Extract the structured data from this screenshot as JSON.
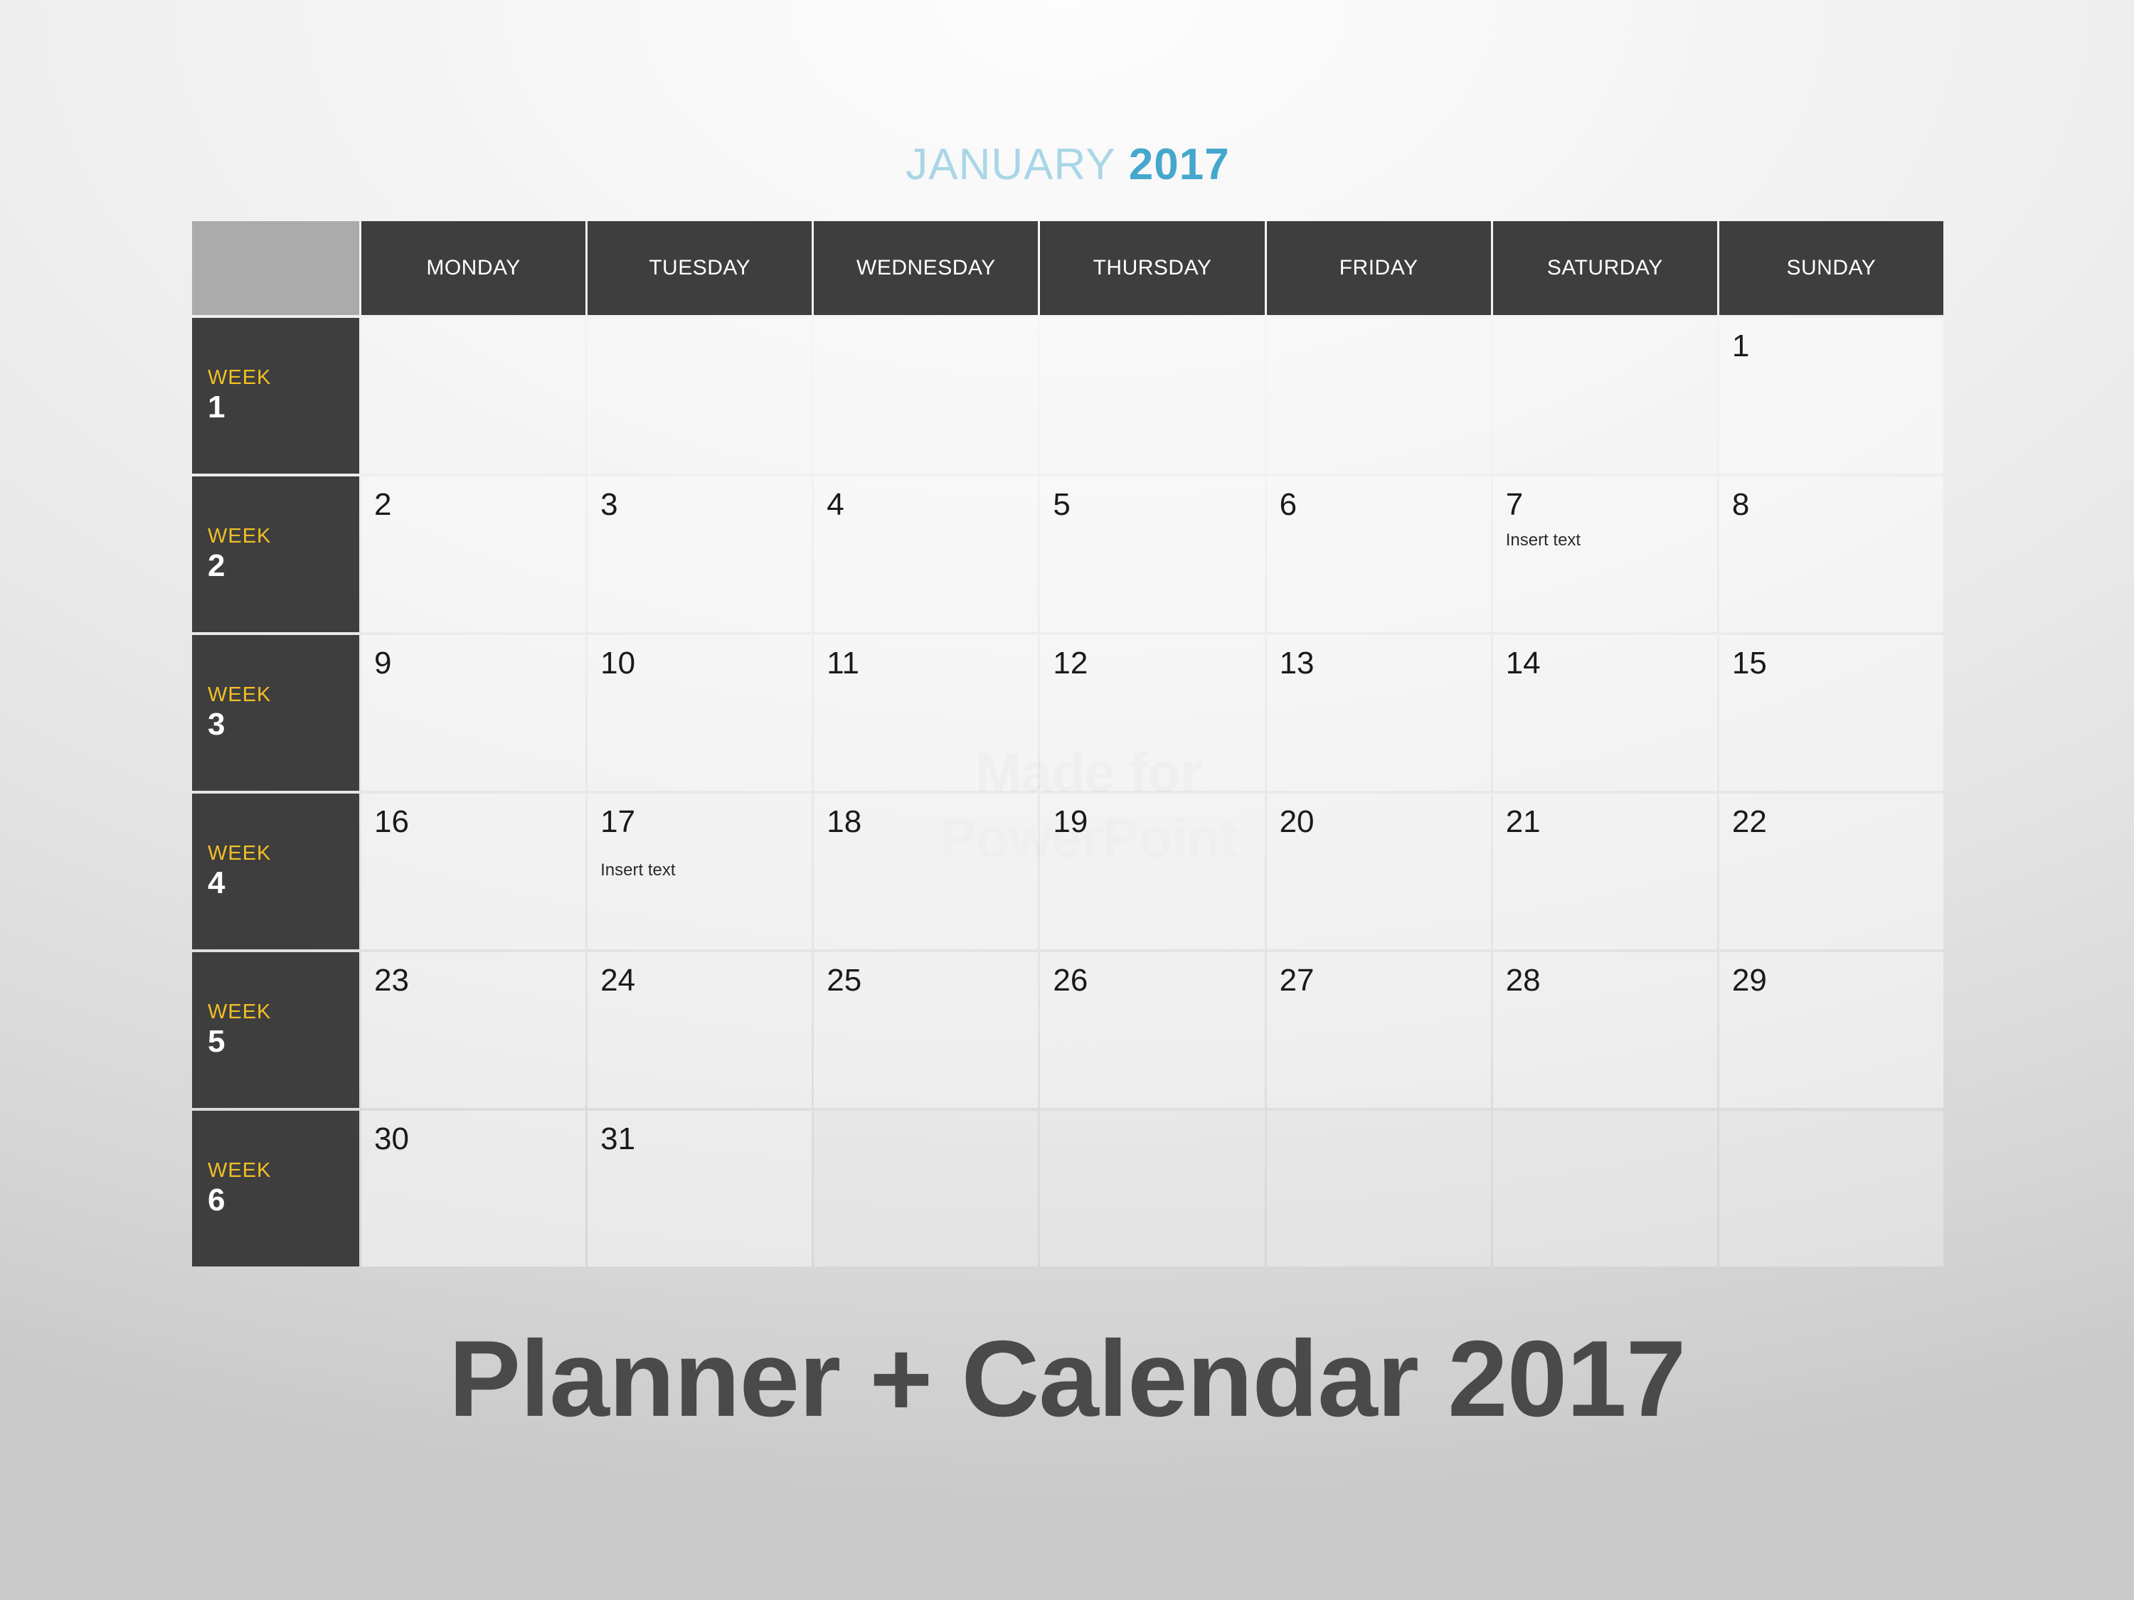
{
  "month_header": {
    "month": "JANUARY",
    "year": "2017",
    "month_color": "#a9d6e7",
    "year_color": "#46a7cd"
  },
  "watermark": {
    "line1": "Made for",
    "line2": "PowerPoint",
    "color": "#e2e2e2"
  },
  "bottom_title": {
    "text": "Planner + Calendar 2017",
    "color": "#4a4a4a"
  },
  "theme": {
    "header_dark": "#3e3e3e",
    "corner_gray": "#ababab",
    "week_accent": "#f2bf24",
    "day_number": "#1a1a1a",
    "page_bg_light": "#fdfdfd",
    "page_bg_dark": "#c9c9c9"
  },
  "calendar": {
    "day_headers": [
      "MONDAY",
      "TUESDAY",
      "WEDNESDAY",
      "THURSDAY",
      "FRIDAY",
      "SATURDAY",
      "SUNDAY"
    ],
    "week_word": "WEEK",
    "weeks": [
      {
        "number": "1",
        "days": [
          {
            "day": "",
            "note": ""
          },
          {
            "day": "",
            "note": ""
          },
          {
            "day": "",
            "note": ""
          },
          {
            "day": "",
            "note": ""
          },
          {
            "day": "",
            "note": ""
          },
          {
            "day": "",
            "note": ""
          },
          {
            "day": "1",
            "note": ""
          }
        ]
      },
      {
        "number": "2",
        "days": [
          {
            "day": "2",
            "note": ""
          },
          {
            "day": "3",
            "note": ""
          },
          {
            "day": "4",
            "note": ""
          },
          {
            "day": "5",
            "note": ""
          },
          {
            "day": "6",
            "note": ""
          },
          {
            "day": "7",
            "note": "Insert text"
          },
          {
            "day": "8",
            "note": ""
          }
        ]
      },
      {
        "number": "3",
        "days": [
          {
            "day": "9",
            "note": ""
          },
          {
            "day": "10",
            "note": ""
          },
          {
            "day": "11",
            "note": ""
          },
          {
            "day": "12",
            "note": ""
          },
          {
            "day": "13",
            "note": ""
          },
          {
            "day": "14",
            "note": ""
          },
          {
            "day": "15",
            "note": ""
          }
        ]
      },
      {
        "number": "4",
        "days": [
          {
            "day": "16",
            "note": ""
          },
          {
            "day": "17",
            "note": "Insert text"
          },
          {
            "day": "18",
            "note": ""
          },
          {
            "day": "19",
            "note": ""
          },
          {
            "day": "20",
            "note": ""
          },
          {
            "day": "21",
            "note": ""
          },
          {
            "day": "22",
            "note": ""
          }
        ]
      },
      {
        "number": "5",
        "days": [
          {
            "day": "23",
            "note": ""
          },
          {
            "day": "24",
            "note": ""
          },
          {
            "day": "25",
            "note": ""
          },
          {
            "day": "26",
            "note": ""
          },
          {
            "day": "27",
            "note": ""
          },
          {
            "day": "28",
            "note": ""
          },
          {
            "day": "29",
            "note": ""
          }
        ]
      },
      {
        "number": "6",
        "days": [
          {
            "day": "30",
            "note": ""
          },
          {
            "day": "31",
            "note": ""
          },
          {
            "day": "",
            "note": ""
          },
          {
            "day": "",
            "note": ""
          },
          {
            "day": "",
            "note": ""
          },
          {
            "day": "",
            "note": ""
          },
          {
            "day": "",
            "note": ""
          }
        ]
      }
    ]
  }
}
